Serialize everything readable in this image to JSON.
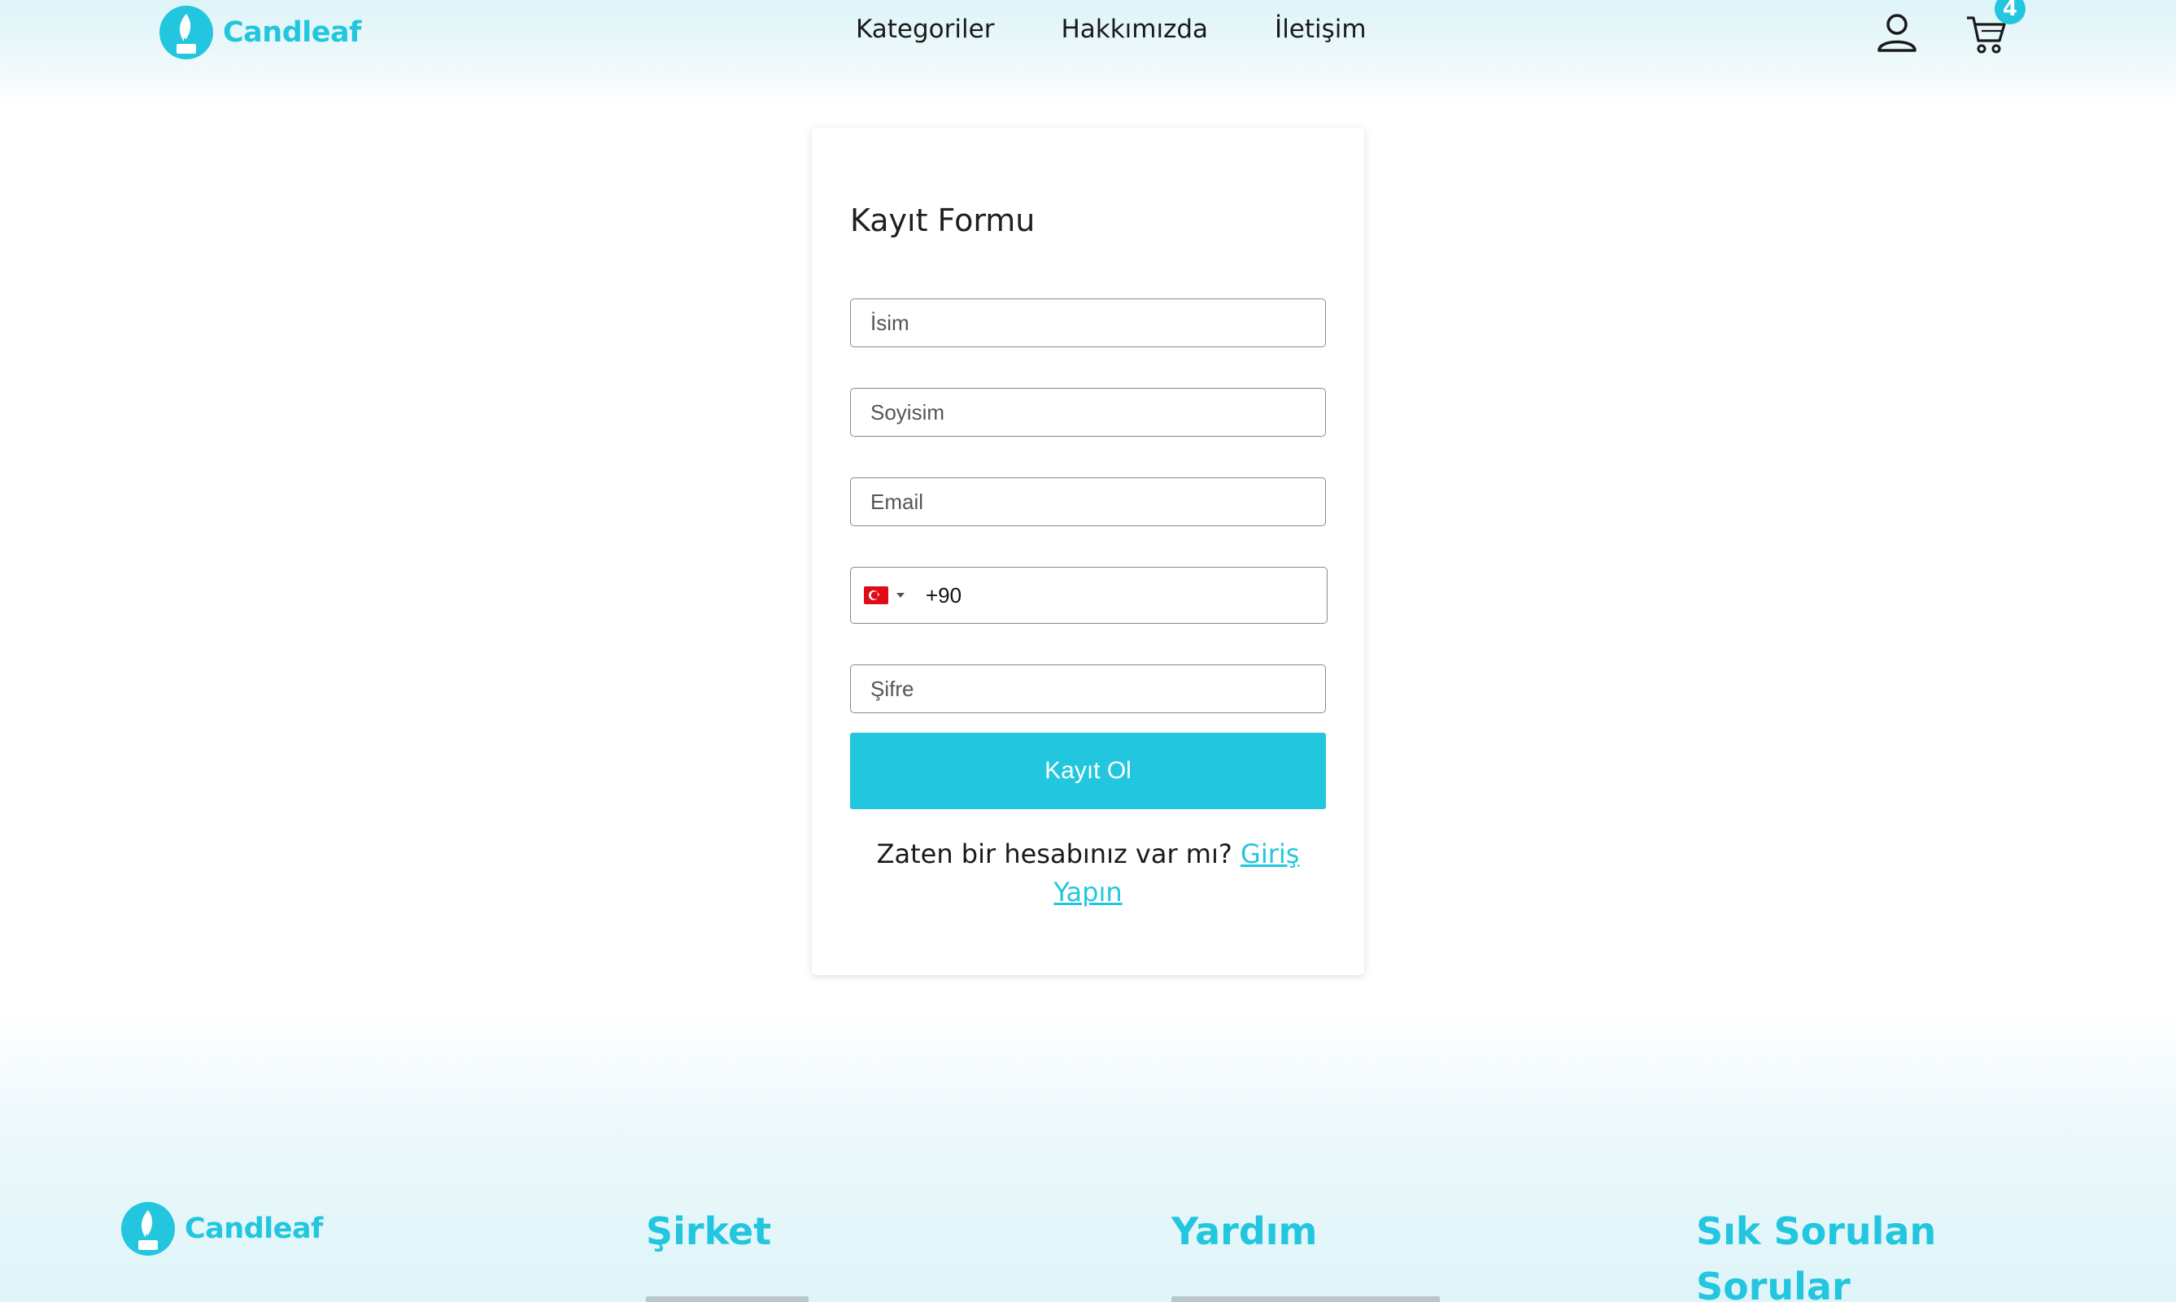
{
  "header": {
    "brand": "Candleaf",
    "nav": [
      "Kategoriler",
      "Hakkımızda",
      "İletişim"
    ],
    "cart_count": "4"
  },
  "form": {
    "title": "Kayıt Formu",
    "fields": {
      "first_name_placeholder": "İsim",
      "last_name_placeholder": "Soyisim",
      "email_placeholder": "Email",
      "phone_code": "+90",
      "password_placeholder": "Şifre"
    },
    "submit_label": "Kayıt Ol",
    "signin_prompt": "Zaten bir hesabınız var mı?",
    "signin_link": "Giriş Yapın"
  },
  "footer": {
    "brand": "Candleaf",
    "columns": [
      "Şirket",
      "Yardım",
      "Sık Sorulan Sorular"
    ]
  },
  "colors": {
    "accent": "#22c6df",
    "flag": "#e30a17"
  },
  "icons": [
    "leaf-logo-icon",
    "user-icon",
    "cart-icon",
    "turkey-flag-icon",
    "caret-down-icon"
  ]
}
